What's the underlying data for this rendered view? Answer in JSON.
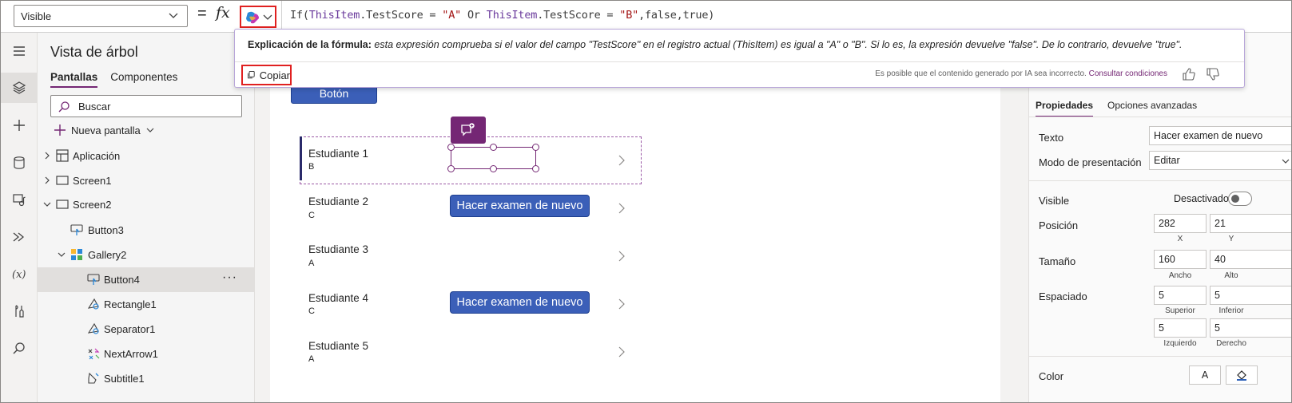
{
  "formula_bar": {
    "property": "Visible",
    "equals": "=",
    "fx": "fx",
    "tokens": {
      "t1": "If(",
      "t2": "ThisItem",
      "t3": ".TestScore = ",
      "t4": "\"A\"",
      "t5": " Or ",
      "t6": "ThisItem",
      "t7": ".TestScore = ",
      "t8": "\"B\"",
      "t9": ",false,true)"
    }
  },
  "rail": {
    "items": [
      "hamburger-icon",
      "layers-icon",
      "plus-icon",
      "database-icon",
      "media-icon",
      "flow-icon",
      "variables-icon",
      "tools-icon",
      "search-icon"
    ]
  },
  "tree": {
    "title": "Vista de árbol",
    "tabs": [
      "Pantallas",
      "Componentes"
    ],
    "search_placeholder": "Buscar",
    "new_screen": "Nueva pantalla",
    "rows": [
      "Aplicación",
      "Screen1",
      "Screen2",
      "Button3",
      "Gallery2",
      "Button4",
      "Rectangle1",
      "Separator1",
      "NextArrow1",
      "Subtitle1"
    ],
    "more": "···"
  },
  "canvas": {
    "boton": "Botón",
    "items": [
      {
        "name": "Estudiante 1",
        "sub": "B"
      },
      {
        "name": "Estudiante 2",
        "sub": "C"
      },
      {
        "name": "Estudiante 3",
        "sub": "A"
      },
      {
        "name": "Estudiante 4",
        "sub": "C"
      },
      {
        "name": "Estudiante 5",
        "sub": "A"
      }
    ],
    "retake_button": "Hacer examen de nuevo"
  },
  "popup": {
    "label": "Explicación de la fórmula:",
    "explanation": "esta expresión comprueba si el valor del campo \"TestScore\" en el registro actual (ThisItem) es igual a \"A\" o \"B\". Si lo es, la expresión devuelve \"false\". De lo contrario, devuelve \"true\".",
    "copy": "Copiar",
    "disclaimer": "Es posible que el contenido generado por IA sea incorrecto.",
    "terms": "Consultar condiciones"
  },
  "properties": {
    "tabs": [
      "Propiedades",
      "Opciones avanzadas"
    ],
    "texto_label": "Texto",
    "texto_value": "Hacer examen de nuevo",
    "modo_label": "Modo de presentación",
    "modo_value": "Editar",
    "visible_label": "Visible",
    "visible_state": "Desactivado",
    "posicion_label": "Posición",
    "pos_x": "282",
    "pos_y": "21",
    "cap_x": "X",
    "cap_y": "Y",
    "tamano_label": "Tamaño",
    "ancho": "160",
    "alto": "40",
    "cap_ancho": "Ancho",
    "cap_alto": "Alto",
    "espaciado_label": "Espaciado",
    "sup": "5",
    "inf": "5",
    "izq": "5",
    "der": "5",
    "cap_sup": "Superior",
    "cap_inf": "Inferior",
    "cap_izq": "Izquierdo",
    "cap_der": "Derecho",
    "color_label": "Color",
    "color_swatch": "A"
  },
  "colors": {
    "accent": "#742774",
    "button": "#3b5fb8",
    "highlight": "#e02020"
  }
}
